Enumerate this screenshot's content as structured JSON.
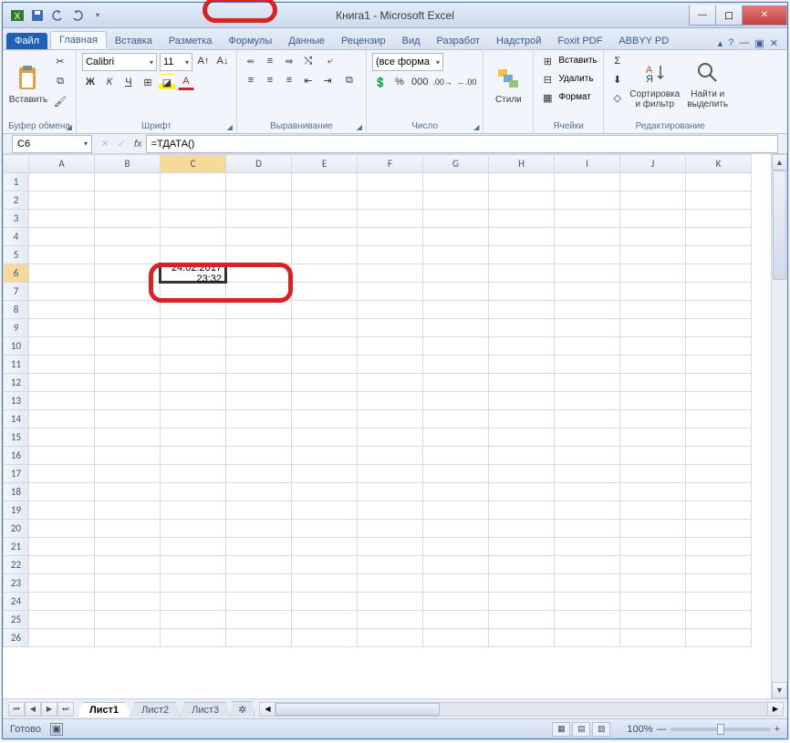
{
  "window": {
    "title": "Книга1 - Microsoft Excel",
    "buttons": {
      "min": "—",
      "max": "口",
      "close": "✕"
    }
  },
  "qat": {
    "save": "save",
    "undo": "undo",
    "redo": "redo"
  },
  "tabs": {
    "file": "Файл",
    "items": [
      "Главная",
      "Вставка",
      "Разметка",
      "Формулы",
      "Данные",
      "Рецензир",
      "Вид",
      "Разработ",
      "Надстрой",
      "Foxit PDF",
      "ABBYY PD"
    ],
    "active": 0
  },
  "ribbon": {
    "clipboard": {
      "label": "Буфер обмена",
      "paste": "Вставить"
    },
    "font": {
      "label": "Шрифт",
      "name": "Calibri",
      "size": "11",
      "bold": "Ж",
      "italic": "К",
      "under": "Ч",
      "border": "⊞",
      "fill": "◪",
      "color": "A"
    },
    "align": {
      "label": "Выравнивание"
    },
    "number": {
      "label": "Число",
      "format": "(все форма",
      "pct": "%",
      "comma": "000",
      "inc": "←0",
      "dec": "0→"
    },
    "styles": {
      "label": "",
      "btn": "Стили"
    },
    "cells": {
      "label": "Ячейки",
      "insert": "Вставить",
      "delete": "Удалить",
      "format": "Формат"
    },
    "editing": {
      "label": "Редактирование",
      "sort": "Сортировка и фильтр",
      "find": "Найти и выделить",
      "sum": "Σ",
      "fill": "⬇",
      "clear": "◇"
    }
  },
  "namebox": "C6",
  "formula": "=ТДАТА()",
  "columns": [
    "A",
    "B",
    "C",
    "D",
    "E",
    "F",
    "G",
    "H",
    "I",
    "J",
    "K"
  ],
  "rows": 26,
  "activeCell": {
    "row": 6,
    "col": "C",
    "value": "24.02.2017 23:32"
  },
  "sheets": {
    "items": [
      "Лист1",
      "Лист2",
      "Лист3"
    ],
    "active": 0
  },
  "status": {
    "ready": "Готово",
    "zoom": "100%",
    "plus": "+",
    "minus": "—"
  }
}
